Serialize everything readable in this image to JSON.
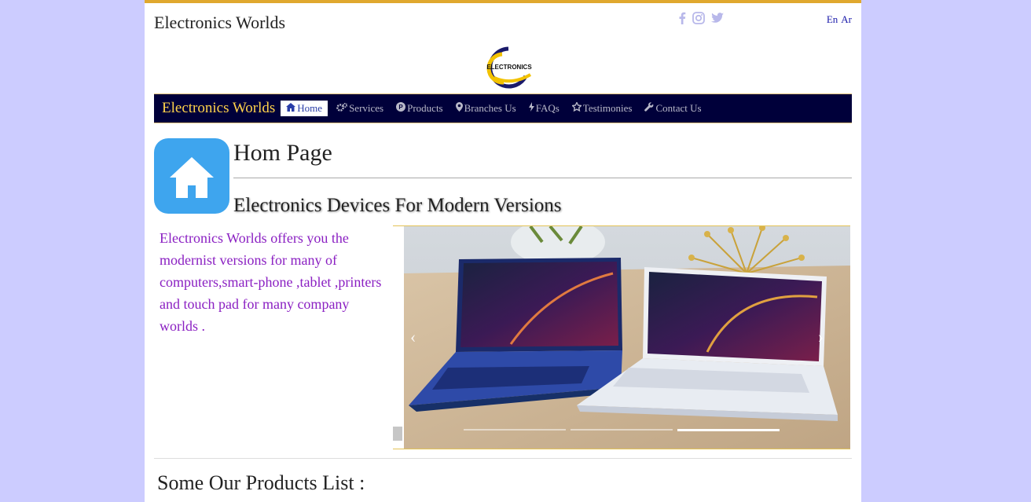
{
  "header": {
    "site_name": "Electronics Worlds",
    "social_icons": [
      "facebook-icon",
      "instagram-icon",
      "twitter-icon"
    ],
    "lang_en": "En",
    "lang_ar": "Ar",
    "logo_text": "ELECTRONICS"
  },
  "navbar": {
    "brand": "Electronics Worlds",
    "items": [
      {
        "label": "Home",
        "icon": "home-icon",
        "active": true
      },
      {
        "label": "Services",
        "icon": "gears-icon"
      },
      {
        "label": "Products",
        "icon": "product-icon"
      },
      {
        "label": "Branches Us",
        "icon": "map-pin-icon"
      },
      {
        "label": "FAQs",
        "icon": "bolt-icon"
      },
      {
        "label": "Testimonies",
        "icon": "star-icon"
      },
      {
        "label": "Contact Us",
        "icon": "wrench-icon"
      }
    ]
  },
  "main": {
    "page_title": "Hom Page",
    "subtitle": "Electronics Devices For Modern Versions",
    "description": "Electronics Worlds offers you the modernist versions for many of computers,smart-phone ,tablet ,printers and touch pad for many company worlds ."
  },
  "products": {
    "title": "Some Our Products List :"
  },
  "colors": {
    "background": "#ccccff",
    "navbar": "#00003a",
    "brand": "#ffd24a",
    "accent": "#e0a82e",
    "description": "#8a1fc2",
    "home_icon_bg": "#3ea5ee"
  }
}
